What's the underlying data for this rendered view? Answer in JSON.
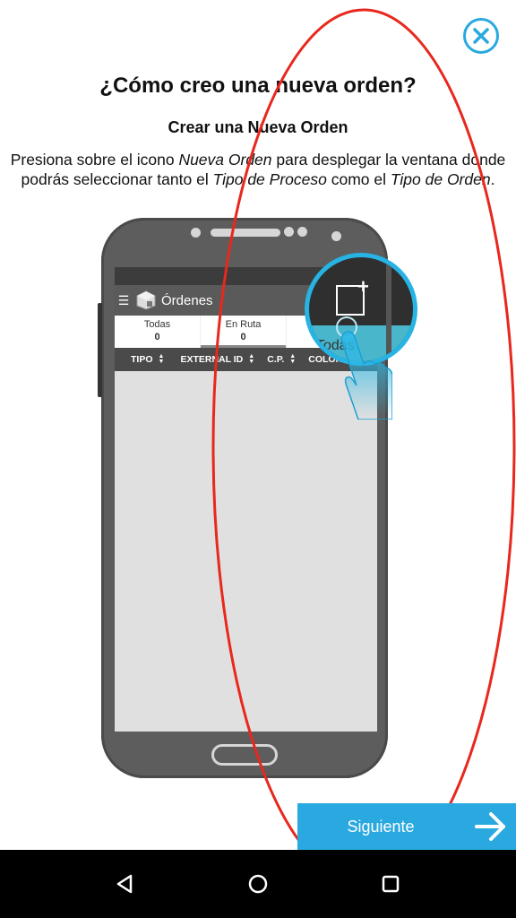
{
  "header": {
    "close_icon": "close-circle-icon"
  },
  "title": "¿Cómo creo una nueva orden?",
  "subtitle": "Crear una Nueva Orden",
  "description": {
    "part1": "Presiona sobre el icono ",
    "em1": "Nueva Orden",
    "part2": " para desplegar la ventana donde podrás seleccionar tanto el ",
    "em2": "Tipo de Proceso",
    "part3": " como el ",
    "em3": "Tipo de Orden",
    "part4": "."
  },
  "phone_screen": {
    "app_title": "Órdenes",
    "tabs": [
      {
        "label": "Todas",
        "count": "0"
      },
      {
        "label": "En Ruta",
        "count": "0"
      }
    ],
    "columns": [
      "TIPO",
      "EXTERNAL ID",
      "C.P.",
      "COLONI"
    ],
    "magnified_label": "Todas"
  },
  "next_button": {
    "label": "Siguiente",
    "icon": "arrow-right-icon"
  },
  "navbar": {
    "back_icon": "back-triangle-icon",
    "home_icon": "home-circle-icon",
    "recents_icon": "recents-square-icon"
  },
  "colors": {
    "accent": "#29a9e0",
    "annotation": "#e8281e",
    "phone_body": "#5d5d5d"
  }
}
